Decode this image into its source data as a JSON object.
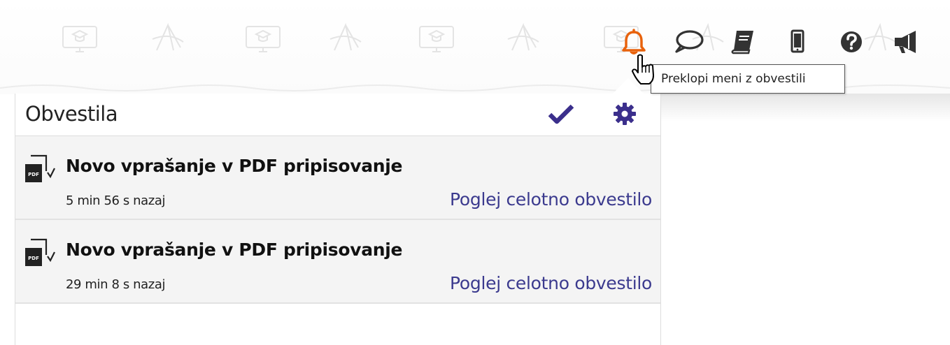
{
  "topbar": {
    "icons": [
      {
        "name": "bell-icon",
        "color": "#e8620c"
      },
      {
        "name": "chat-bubble-icon",
        "color": "#333333"
      },
      {
        "name": "book-icon",
        "color": "#333333"
      },
      {
        "name": "mobile-phone-icon",
        "color": "#333333"
      },
      {
        "name": "help-icon",
        "color": "#333333"
      },
      {
        "name": "megaphone-icon",
        "color": "#333333"
      }
    ],
    "tooltip": "Preklopi meni z obvestili"
  },
  "notifications_panel": {
    "title": "Obvestila",
    "mark_all_read_icon": "checkmark-icon",
    "settings_icon": "gear-icon",
    "accent_color": "#3b2f8c",
    "items": [
      {
        "icon": "pdf-annotation-icon",
        "title": "Novo vprašanje v PDF pripisovanje",
        "time": "5 min 56 s nazaj",
        "link": "Poglej celotno obvestilo"
      },
      {
        "icon": "pdf-annotation-icon",
        "title": "Novo vprašanje v PDF pripisovanje",
        "time": "29 min 8 s nazaj",
        "link": "Poglej celotno obvestilo"
      }
    ]
  }
}
